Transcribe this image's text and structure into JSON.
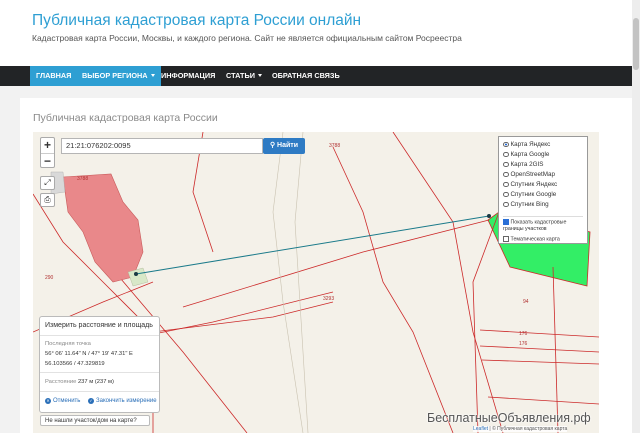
{
  "header": {
    "site_title": "Публичная кадастровая карта России онлайн",
    "site_description": "Кадастровая карта России, Москвы, и каждого региона. Сайт не является официальным сайтом Росреестра"
  },
  "nav": {
    "items": [
      {
        "label": "Главная"
      },
      {
        "label": "Выбор региона"
      },
      {
        "label": "Информация"
      },
      {
        "label": "Статьи"
      },
      {
        "label": "Обратная связь"
      }
    ]
  },
  "page": {
    "title": "Публичная кадастровая карта России"
  },
  "map": {
    "search_value": "21:21:076202:0095",
    "search_button": "Найти",
    "zoom_in": "+",
    "zoom_out": "−",
    "tool_fullscreen": "⤢",
    "tool_print": "⎙",
    "layers": {
      "base": [
        {
          "label": "Карта Яндекс",
          "selected": true
        },
        {
          "label": "Карта Google",
          "selected": false
        },
        {
          "label": "Карта 2GIS",
          "selected": false
        },
        {
          "label": "OpenStreetMap",
          "selected": false
        },
        {
          "label": "Спутник Яндекс",
          "selected": false
        },
        {
          "label": "Спутник Google",
          "selected": false
        },
        {
          "label": "Спутник Bing",
          "selected": false
        }
      ],
      "overlay_cadastral": "Показать кадастровые границы участков",
      "overlay_cadastral_checked": true,
      "overlay_thematic": "Тематическая карта",
      "overlay_thematic_checked": false
    },
    "parcel_labels": [
      "3788",
      "3293",
      "94",
      "176",
      "176",
      "290",
      "3788"
    ],
    "measure": {
      "title": "Измерить расстояние и площадь",
      "last_point_label": "Последняя точка",
      "coords_dms": "56° 06' 11.64\" N / 47° 19' 47.31\" E",
      "coords_dec": "56.103566 / 47.329819",
      "distance_label": "Расстояние",
      "distance_value": "237 м (237 м)",
      "cancel_label": "Отменить",
      "finish_label": "Закончить измерение"
    },
    "not_found_link": "Не нашли участок/дом на карте?",
    "attribution_leaflet": "Leaflet",
    "attribution_rest": " | © Публичная кадастровая карта"
  },
  "watermark": "БесплатныеОбъявления.рф",
  "colors": {
    "accent": "#2e9fd3",
    "nav_bg": "#222426",
    "parcel_line": "#cc2a2a",
    "selected_parcel": "#33ee66",
    "measure_line": "#1a7a8a",
    "building": "#e9888a"
  }
}
